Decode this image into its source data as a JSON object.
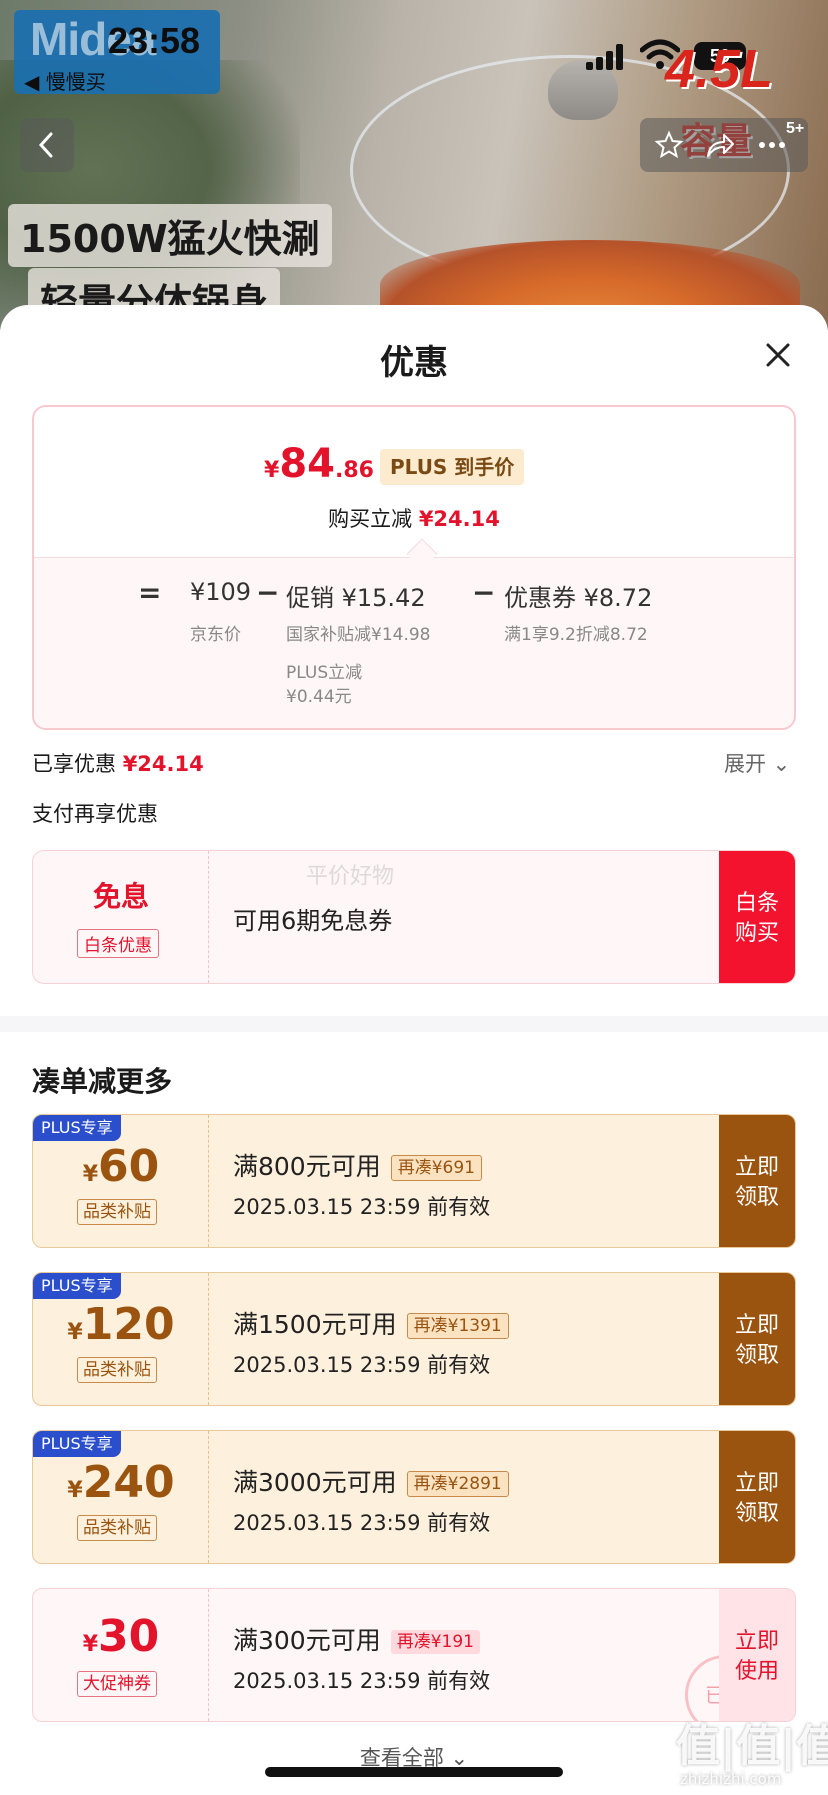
{
  "status_bar": {
    "time": "23:58",
    "back_app": "◀ 慢慢买",
    "battery": "50"
  },
  "hero": {
    "brand": "Midea",
    "capacity": "4.5L",
    "capacity_sub": "容量",
    "image_badge": "5+",
    "slogan_1": "1500W猛火快涮",
    "slogan_2": "轻量分体锅身"
  },
  "sheet": {
    "title": "优惠"
  },
  "price_card": {
    "final_symbol": "¥",
    "final_int": "84",
    "final_dec": ".86",
    "plus_tag": "PLUS 到手价",
    "reduce_label": "购买立减",
    "reduce_amount": "¥24.14",
    "eq": "=",
    "jd_price": "¥109",
    "jd_price_label": "京东价",
    "minus_1": "−",
    "promo": "促销 ¥15.42",
    "promo_detail_1": "国家补贴减¥14.98",
    "promo_detail_2_line1": "PLUS立减",
    "promo_detail_2_line2": "¥0.44元",
    "minus_2": "−",
    "coupon": "优惠券 ¥8.72",
    "coupon_detail": "满1享9.2折减8.72"
  },
  "summary": {
    "enjoyed_label": "已享优惠",
    "enjoyed_amount": "¥24.14",
    "expand": "展开 ⌄",
    "pay_more": "支付再享优惠"
  },
  "interest_free": {
    "big": "免息",
    "tag": "白条优惠",
    "text": "可用6期免息券",
    "button_line1": "白条",
    "button_line2": "购买",
    "watermark": "平价好物"
  },
  "more_section": {
    "title": "凑单减更多"
  },
  "coupons": [
    {
      "plus": "PLUS专享",
      "symbol": "¥",
      "amount": "60",
      "tag": "品类补贴",
      "condition": "满800元可用",
      "need": "再凑¥691",
      "valid": "2025.03.15 23:59 前有效",
      "button_line1": "立即",
      "button_line2": "领取"
    },
    {
      "plus": "PLUS专享",
      "symbol": "¥",
      "amount": "120",
      "tag": "品类补贴",
      "condition": "满1500元可用",
      "need": "再凑¥1391",
      "valid": "2025.03.15 23:59 前有效",
      "button_line1": "立即",
      "button_line2": "领取"
    },
    {
      "plus": "PLUS专享",
      "symbol": "¥",
      "amount": "240",
      "tag": "品类补贴",
      "condition": "满3000元可用",
      "need": "再凑¥2891",
      "valid": "2025.03.15 23:59 前有效",
      "button_line1": "立即",
      "button_line2": "领取"
    },
    {
      "symbol": "¥",
      "amount": "30",
      "tag": "大促神券",
      "condition": "满300元可用",
      "need": "再凑¥191",
      "valid": "2025.03.15 23:59 前有效",
      "button_line1": "立即",
      "button_line2": "使用",
      "stamp": "已领"
    }
  ],
  "footer": {
    "view_all": "查看全部 ⌄",
    "site_mark": "值|值|值",
    "site_url": "zhizhizhi.com"
  },
  "colors": {
    "accent_red": "#e3132c",
    "gold": "#9a5410",
    "plus_blue": "#2b4fcc"
  }
}
